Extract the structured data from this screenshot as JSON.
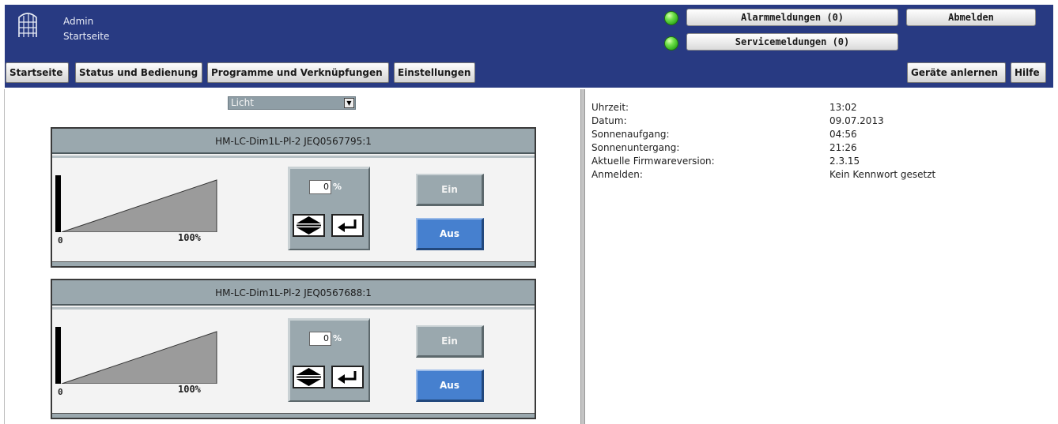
{
  "header": {
    "user": "Admin",
    "page": "Startseite",
    "alarm_label": "Alarmmeldungen (0)",
    "service_label": "Servicemeldungen (0)",
    "logout_label": "Abmelden",
    "led_alarm_color": "#2aa818",
    "led_service_color": "#2aa818",
    "brand_color": "#283a82"
  },
  "nav": {
    "tabs": [
      {
        "label": "Startseite"
      },
      {
        "label": "Status und Bedienung"
      },
      {
        "label": "Programme und Verknüpfungen"
      },
      {
        "label": "Einstellungen"
      }
    ],
    "teach_label": "Geräte anlernen",
    "help_label": "Hilfe"
  },
  "left": {
    "category_select": "Licht",
    "devices": [
      {
        "name": "HM-LC-Dim1L-Pl-2 JEQ0567795:1",
        "level_min_label": "0",
        "level_max_label": "100%",
        "level_value": "0",
        "percent_sign": "%",
        "on_label": "Ein",
        "off_label": "Aus"
      },
      {
        "name": "HM-LC-Dim1L-Pl-2 JEQ0567688:1",
        "level_min_label": "0",
        "level_max_label": "100%",
        "level_value": "0",
        "percent_sign": "%",
        "on_label": "Ein",
        "off_label": "Aus"
      }
    ]
  },
  "info": {
    "rows": [
      {
        "key": "Uhrzeit:",
        "value": "13:02"
      },
      {
        "key": "Datum:",
        "value": "09.07.2013"
      },
      {
        "key": "Sonnenaufgang:",
        "value": "04:56"
      },
      {
        "key": "Sonnenuntergang:",
        "value": "21:26"
      },
      {
        "key": "Aktuelle Firmwareversion:",
        "value": "2.3.15"
      },
      {
        "key": "Anmelden:",
        "value": "Kein Kennwort gesetzt"
      }
    ]
  }
}
